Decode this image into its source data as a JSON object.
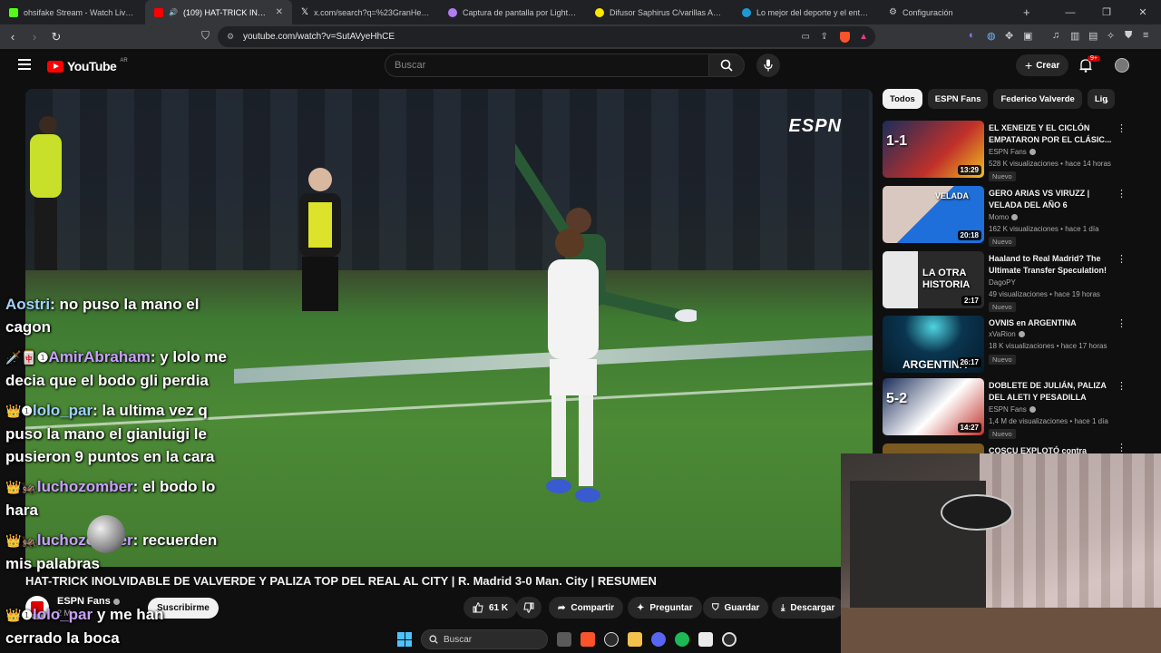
{
  "browser": {
    "tabs": [
      {
        "title": "ohsifake Stream - Watch Live on Kick",
        "color": "#53fc18",
        "active": false
      },
      {
        "title": "(109) HAT-TRICK INOLVIDABL",
        "color": "#ff0000",
        "active": true
      },
      {
        "title": "x.com/search?q=%23GranHermano",
        "color": "#ffffff",
        "active": false
      },
      {
        "title": "Captura de pantalla por Lightshot",
        "color": "#b27cf2",
        "active": false
      },
      {
        "title": "Difusor Saphirus C/varillas Aroma Cit",
        "color": "#ffe600",
        "active": false
      },
      {
        "title": "Lo mejor del deporte y el entretenim",
        "color": "#1a9bd8",
        "active": false
      },
      {
        "title": "Configuración",
        "color": "#aaaaaa",
        "active": false
      }
    ],
    "url": "youtube.com/watch?v=SutAVyeHhCE"
  },
  "youtube": {
    "logo": "YouTube",
    "country": "AR",
    "search_placeholder": "Buscar",
    "create_label": "Crear",
    "notif_badge": "9+"
  },
  "video": {
    "watermark": "ESPN",
    "title": "HAT-TRICK INOLVIDABLE DE VALVERDE Y PALIZA TOP DEL REAL AL CITY | R. Madrid 3-0 Man. City | RESUMEN",
    "channel": "ESPN Fans",
    "subscribers": "2 M",
    "subscribe_label": "Suscribirme",
    "likes": "61 K",
    "share_label": "Compartir",
    "ask_label": "Preguntar",
    "save_label": "Guardar",
    "download_label": "Descargar"
  },
  "chat": [
    {
      "user": "Aostri",
      "text": " no puso la mano el cagon",
      "badges": ""
    },
    {
      "user": "AmirAbraham",
      "text": " y lolo me decia que el bodo gli perdia",
      "badges": "🗡️🀄❶"
    },
    {
      "user": "lolo_par",
      "text": " la ultima vez q puso la mano el gianluigi le pusieron 9 puntos en la cara",
      "badges": "👑❶"
    },
    {
      "user": "luchozomber",
      "text": " el bodo lo hara",
      "badges": "👑🦗"
    },
    {
      "user": "luchozomber",
      "text": " recuerden mis palabras",
      "badges": "👑🦗"
    },
    {
      "user": "lolo_par",
      "text": " y me han cerrado la boca",
      "badges": "👑❶"
    }
  ],
  "sidebar": {
    "chips": [
      "Todos",
      "ESPN Fans",
      "Federico Valverde",
      "Lig"
    ],
    "items": [
      {
        "title": "EL XENEIZE Y EL CICLÓN EMPATARON POR EL CLÁSIC...",
        "channel": "ESPN Fans",
        "verified": true,
        "views": "528 K visualizaciones",
        "age": "hace 14 horas",
        "badge": "Nuevo",
        "duration": "13:29",
        "thumb_text": "1-1",
        "thumb_color": "#1b2d5a"
      },
      {
        "title": "GERO ARIAS VS VIRUZZ | VELADA DEL AÑO 6",
        "channel": "Momo",
        "verified": true,
        "views": "162 K visualizaciones",
        "age": "hace 1 día",
        "badge": "Nuevo",
        "duration": "20:18",
        "thumb_text": "VELADA",
        "thumb_color": "#1e6fd9"
      },
      {
        "title": "Haaland to Real Madrid? The Ultimate Transfer Speculation!",
        "channel": "DagoPY",
        "verified": false,
        "views": "49 visualizaciones",
        "age": "hace 19 horas",
        "badge": "Nuevo",
        "duration": "2:17",
        "thumb_text": "LA OTRA HISTORIA",
        "thumb_color": "#3a3a3a"
      },
      {
        "title": "OVNIS en ARGENTINA",
        "channel": "xVaRion",
        "verified": true,
        "views": "18 K visualizaciones",
        "age": "hace 17 horas",
        "badge": "Nuevo",
        "duration": "26:17",
        "thumb_text": "ARGENTINA",
        "thumb_color": "#0a3550"
      },
      {
        "title": "DOBLETE DE JULIÁN, PALIZA DEL ALETI Y PESADILLA PARA...",
        "channel": "ESPN Fans",
        "verified": true,
        "views": "1,4 M de visualizaciones",
        "age": "hace 1 día",
        "badge": "Nuevo",
        "duration": "14:27",
        "thumb_text": "5-2",
        "thumb_color": "#1b2d5a"
      },
      {
        "title": "COSCU EXPLOTÓ contra",
        "channel": "",
        "verified": false,
        "views": "",
        "age": "",
        "badge": "",
        "duration": "",
        "thumb_text": "",
        "thumb_color": "#7a5a20"
      }
    ]
  },
  "taskbar": {
    "search_label": "Buscar"
  }
}
